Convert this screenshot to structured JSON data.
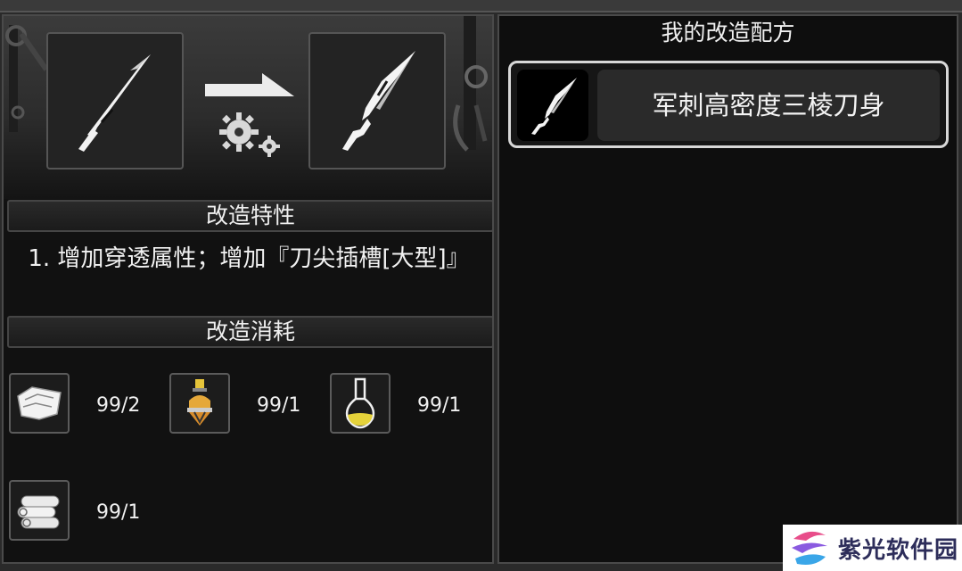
{
  "left": {
    "trait_header": "改造特性",
    "trait_text": "1. 增加穿透属性；增加『刀尖插槽[大型]』",
    "cost_header": "改造消耗",
    "materials": [
      {
        "icon": "cloth-icon",
        "count": "99/2"
      },
      {
        "icon": "potion-lantern-icon",
        "count": "99/1"
      },
      {
        "icon": "flask-icon",
        "count": "99/1"
      },
      {
        "icon": "scroll-icon",
        "count": "99/1"
      }
    ]
  },
  "right": {
    "title": "我的改造配方",
    "recipes": [
      {
        "name": "军刺高密度三棱刀身",
        "icon": "blade-icon",
        "selected": true
      }
    ]
  },
  "watermark": {
    "text": "紫光软件园"
  },
  "colors": {
    "accent_yellow": "#e5c43a",
    "panel_bg": "#111111",
    "border": "#4a4a4a"
  }
}
